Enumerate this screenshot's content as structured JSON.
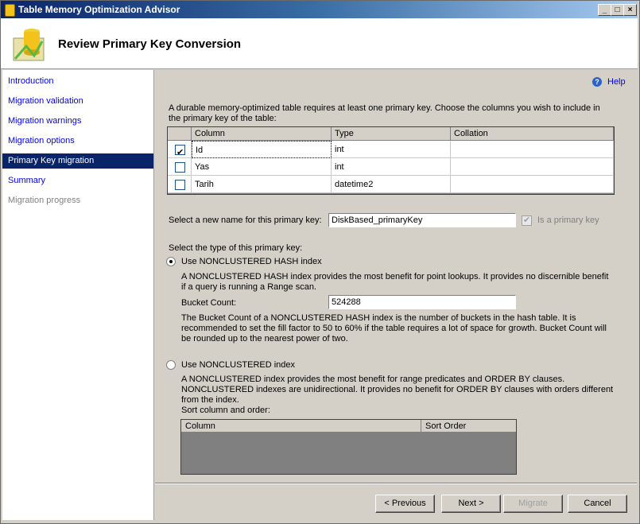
{
  "window": {
    "title": "Table Memory Optimization Advisor"
  },
  "header": {
    "title": "Review Primary Key Conversion"
  },
  "nav": {
    "items": [
      {
        "label": "Introduction",
        "state": "link"
      },
      {
        "label": "Migration validation",
        "state": "link"
      },
      {
        "label": "Migration warnings",
        "state": "link"
      },
      {
        "label": "Migration options",
        "state": "link"
      },
      {
        "label": "Primary Key migration",
        "state": "active"
      },
      {
        "label": "Summary",
        "state": "link"
      },
      {
        "label": "Migration progress",
        "state": "disabled"
      }
    ]
  },
  "help": {
    "label": "Help"
  },
  "intro_text": "A durable memory-optimized table requires at least one primary key. Choose the columns you wish to include in the primary key of the table:",
  "pk_grid": {
    "headers": [
      "Column",
      "Type",
      "Collation"
    ],
    "rows": [
      {
        "checked": true,
        "column": "Id",
        "type": "int",
        "collation": ""
      },
      {
        "checked": false,
        "column": "Yas",
        "type": "int",
        "collation": ""
      },
      {
        "checked": false,
        "column": "Tarih",
        "type": "datetime2",
        "collation": ""
      }
    ]
  },
  "pk_name": {
    "label": "Select a new name for this primary key:",
    "value": "DiskBased_primaryKey",
    "is_primary_label": "Is a primary key",
    "is_primary_checked": true
  },
  "type_label": "Select the type of this primary key:",
  "hash_option": {
    "label": "Use NONCLUSTERED HASH index",
    "selected": true,
    "description": "A NONCLUSTERED HASH index provides the most benefit for point lookups. It provides no discernible benefit if a query is running a Range scan.",
    "bucket_label": "Bucket Count:",
    "bucket_value": "524288",
    "bucket_note": "The Bucket Count of a NONCLUSTERED HASH index is the number of buckets in the hash table. It is recommended to set the fill factor to 50 to 60% if the table requires a lot of space for growth. Bucket Count will be rounded up to the nearest power of two."
  },
  "nonclustered_option": {
    "label": "Use NONCLUSTERED index",
    "selected": false,
    "description": "A NONCLUSTERED index provides the most benefit for range predicates and ORDER BY clauses. NONCLUSTERED indexes are unidirectional. It provides no benefit for ORDER BY clauses with orders different from the index.",
    "sort_label": "Sort column and order:",
    "sort_headers": [
      "Column",
      "Sort Order"
    ]
  },
  "buttons": {
    "previous": "< Previous",
    "next": "Next >",
    "migrate": "Migrate",
    "cancel": "Cancel"
  }
}
